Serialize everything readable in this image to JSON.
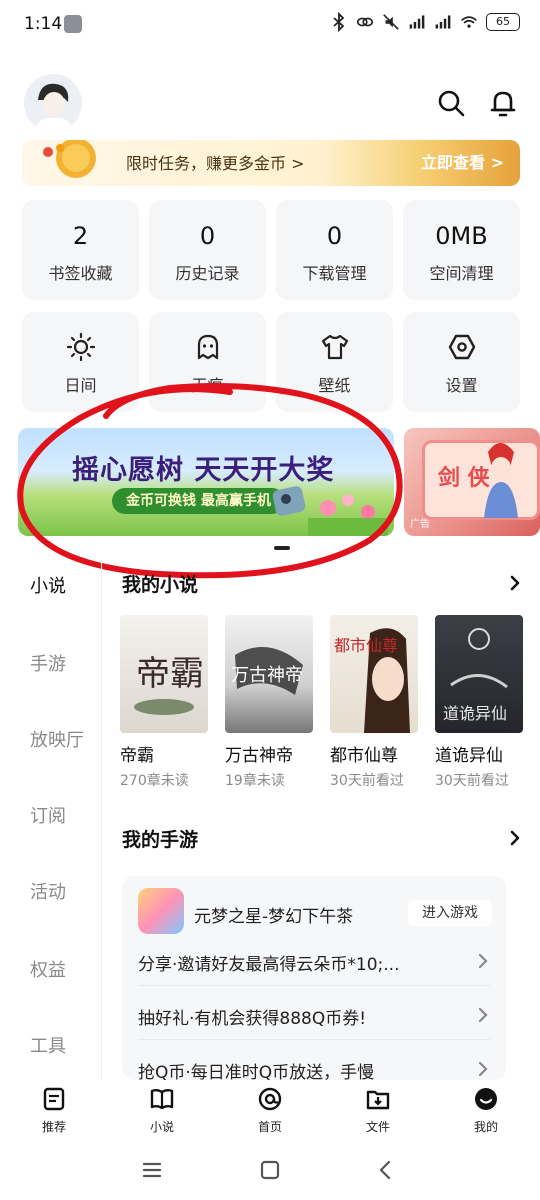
{
  "status_bar": {
    "time": "1:14",
    "battery": "65"
  },
  "promo": {
    "text": "限时任务，赚更多金币 >",
    "cta": "立即查看 >"
  },
  "stats": [
    {
      "value": "2",
      "label": "书签收藏"
    },
    {
      "value": "0",
      "label": "历史记录"
    },
    {
      "value": "0",
      "label": "下载管理"
    },
    {
      "value": "0MB",
      "label": "空间清理"
    }
  ],
  "tools": [
    {
      "label": "日间",
      "icon": "sun-icon"
    },
    {
      "label": "无痕",
      "icon": "ghost-icon"
    },
    {
      "label": "壁纸",
      "icon": "shirt-icon"
    },
    {
      "label": "设置",
      "icon": "settings-icon"
    }
  ],
  "ads": {
    "main_title": "摇心愿树 天天开大奖",
    "main_sub": "金币可换钱 最高赢手机",
    "side_title": "剑 侠",
    "side_tag": "广告"
  },
  "side_nav": [
    "小说",
    "手游",
    "放映厅",
    "订阅",
    "活动",
    "权益",
    "工具"
  ],
  "novels": {
    "title": "我的小说",
    "books": [
      {
        "title": "帝霸",
        "status": "270章未读",
        "cover_text": "帝霸"
      },
      {
        "title": "万古神帝",
        "status": "19章未读",
        "cover_text": "万古神帝"
      },
      {
        "title": "都市仙尊",
        "status": "30天前看过",
        "cover_text": "都市仙尊"
      },
      {
        "title": "道诡异仙",
        "status": "30天前看过",
        "cover_text": "道诡异仙"
      }
    ]
  },
  "games": {
    "title": "我的手游",
    "game_name": "元梦之星-梦幻下午茶",
    "enter_label": "进入游戏",
    "rows": [
      "分享·邀请好友最高得云朵币*10;...",
      "抽好礼·有机会获得888Q币券!",
      "抢Q币·每日准时Q币放送，手慢"
    ]
  },
  "bottom_nav": [
    {
      "label": "推荐",
      "icon": "document-icon"
    },
    {
      "label": "小说",
      "icon": "book-icon"
    },
    {
      "label": "首页",
      "icon": "home-at-icon"
    },
    {
      "label": "文件",
      "icon": "folder-download-icon"
    },
    {
      "label": "我的",
      "icon": "profile-icon"
    }
  ],
  "colors": {
    "annotation": "#e0121b",
    "accent": "#e6a23a"
  }
}
